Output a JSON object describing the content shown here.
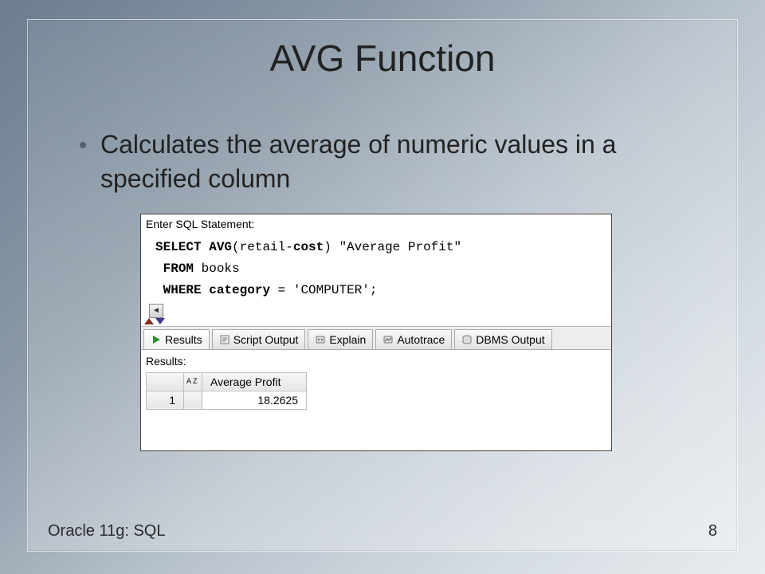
{
  "slide": {
    "title": "AVG Function",
    "bullet": "Calculates the average of numeric values in a specified column",
    "footer_left": "Oracle 11g: SQL",
    "page_number": "8"
  },
  "sql_panel": {
    "prompt_label": "Enter SQL Statement:",
    "code": {
      "kw_select": "SELECT",
      "kw_avg": "AVG",
      "expr_open": "(retail-",
      "kw_cost": "cost",
      "expr_close": ") \"Average Profit\"",
      "kw_from": "FROM",
      "from_table": " books",
      "kw_where": "WHERE",
      "kw_category": "category",
      "where_rest": " = 'COMPUTER';"
    },
    "tabs": [
      {
        "label": "Results",
        "icon": "play-icon"
      },
      {
        "label": "Script Output",
        "icon": "script-icon"
      },
      {
        "label": "Explain",
        "icon": "explain-icon"
      },
      {
        "label": "Autotrace",
        "icon": "autotrace-icon"
      },
      {
        "label": "DBMS Output",
        "icon": "dbms-icon"
      }
    ],
    "results_label": "Results:",
    "grid": {
      "az_label": "A\nZ",
      "column_header": "Average Profit",
      "row_number": "1",
      "value": "18.2625"
    }
  }
}
